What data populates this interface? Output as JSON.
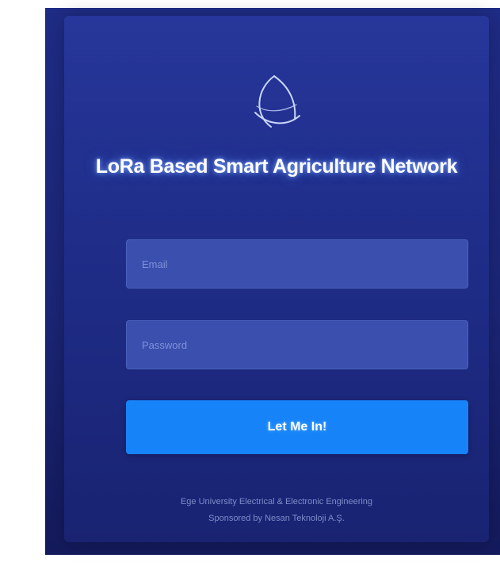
{
  "login": {
    "title": "LoRa Based Smart Agriculture Network",
    "email_placeholder": "Email",
    "password_placeholder": "Password",
    "submit_label": "Let Me In!",
    "footer_line_1": "Ege University Electrical & Electronic Engineering",
    "footer_line_2": "Sponsored by Nesan Teknoloji A.Ş."
  },
  "colors": {
    "background": "#1f2c86",
    "field": "#3a4fae",
    "button": "#1684f8",
    "footer_text": "#7e8cc8"
  },
  "icons": {
    "logo": "globe-orbit-icon"
  }
}
